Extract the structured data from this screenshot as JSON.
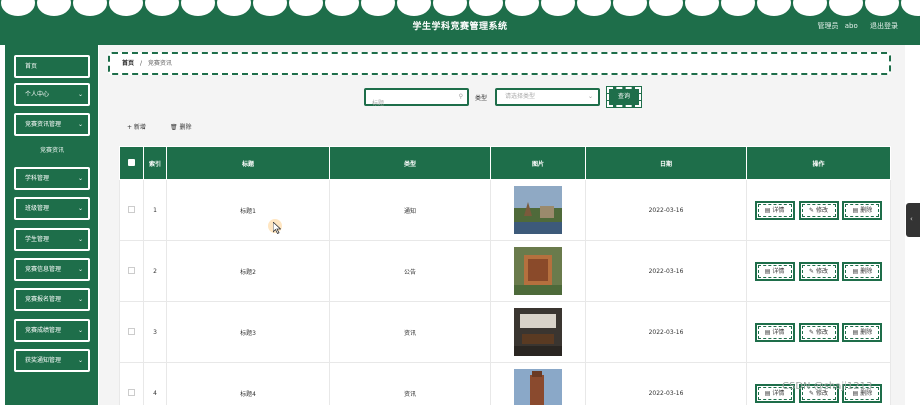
{
  "header": {
    "title": "学生学科竞赛管理系统",
    "role": "管理员",
    "username": "abo",
    "logout_label": "退出登录"
  },
  "sidebar": {
    "items": [
      {
        "label": "首页",
        "has_chevron": false
      },
      {
        "label": "个人中心",
        "has_chevron": true
      },
      {
        "label": "竞赛资讯管理",
        "has_chevron": true
      },
      {
        "label": "竞赛资讯",
        "is_submenu": true
      },
      {
        "label": "学科管理",
        "has_chevron": true
      },
      {
        "label": "班级管理",
        "has_chevron": true
      },
      {
        "label": "学生管理",
        "has_chevron": true
      },
      {
        "label": "竞赛信息管理",
        "has_chevron": true
      },
      {
        "label": "竞赛报名管理",
        "has_chevron": true
      },
      {
        "label": "竞赛成绩管理",
        "has_chevron": true
      },
      {
        "label": "获奖通知管理",
        "has_chevron": true
      }
    ]
  },
  "breadcrumb": {
    "home": "首页",
    "separator": "/",
    "current": "竞赛资讯"
  },
  "search": {
    "title_placeholder": "标题",
    "type_label": "类型",
    "type_placeholder": "请选择类型",
    "query_label": "查询"
  },
  "actions": {
    "add_label": "+ 新增",
    "delete_label": "删除"
  },
  "table": {
    "headers": [
      "索引",
      "标题",
      "类型",
      "图片",
      "日期",
      "操作"
    ],
    "rows": [
      {
        "index": "1",
        "title": "标题1",
        "type": "通知",
        "date": "2022-03-16"
      },
      {
        "index": "2",
        "title": "标题2",
        "type": "公告",
        "date": "2022-03-16"
      },
      {
        "index": "3",
        "title": "标题3",
        "type": "资讯",
        "date": "2022-03-16"
      },
      {
        "index": "4",
        "title": "标题4",
        "type": "资讯",
        "date": "2022-03-16"
      }
    ],
    "op_labels": {
      "detail": "详情",
      "edit": "修改",
      "delete": "删除"
    }
  },
  "watermark": "CSDN @shaji1213",
  "colors": {
    "primary_green": "#1e6e4a",
    "background": "#f4f4f4"
  }
}
